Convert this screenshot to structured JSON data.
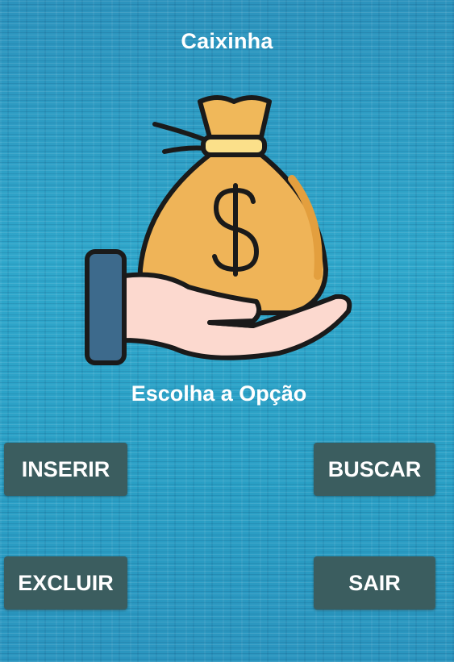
{
  "app": {
    "title": "Caixinha",
    "subtitle": "Escolha a Opção"
  },
  "hero_image": {
    "icon": "money-bag-in-hand-icon",
    "symbol": "$"
  },
  "buttons": {
    "inserir": "INSERIR",
    "buscar": "BUSCAR",
    "excluir": "EXCLUIR",
    "sair": "SAIR"
  },
  "colors": {
    "background": "#2aa0c4",
    "button": "#3b5d5f",
    "text": "#ffffff",
    "bag": "#f0b85a",
    "hand": "#fcd9cf",
    "sleeve": "#3d6a8c"
  }
}
